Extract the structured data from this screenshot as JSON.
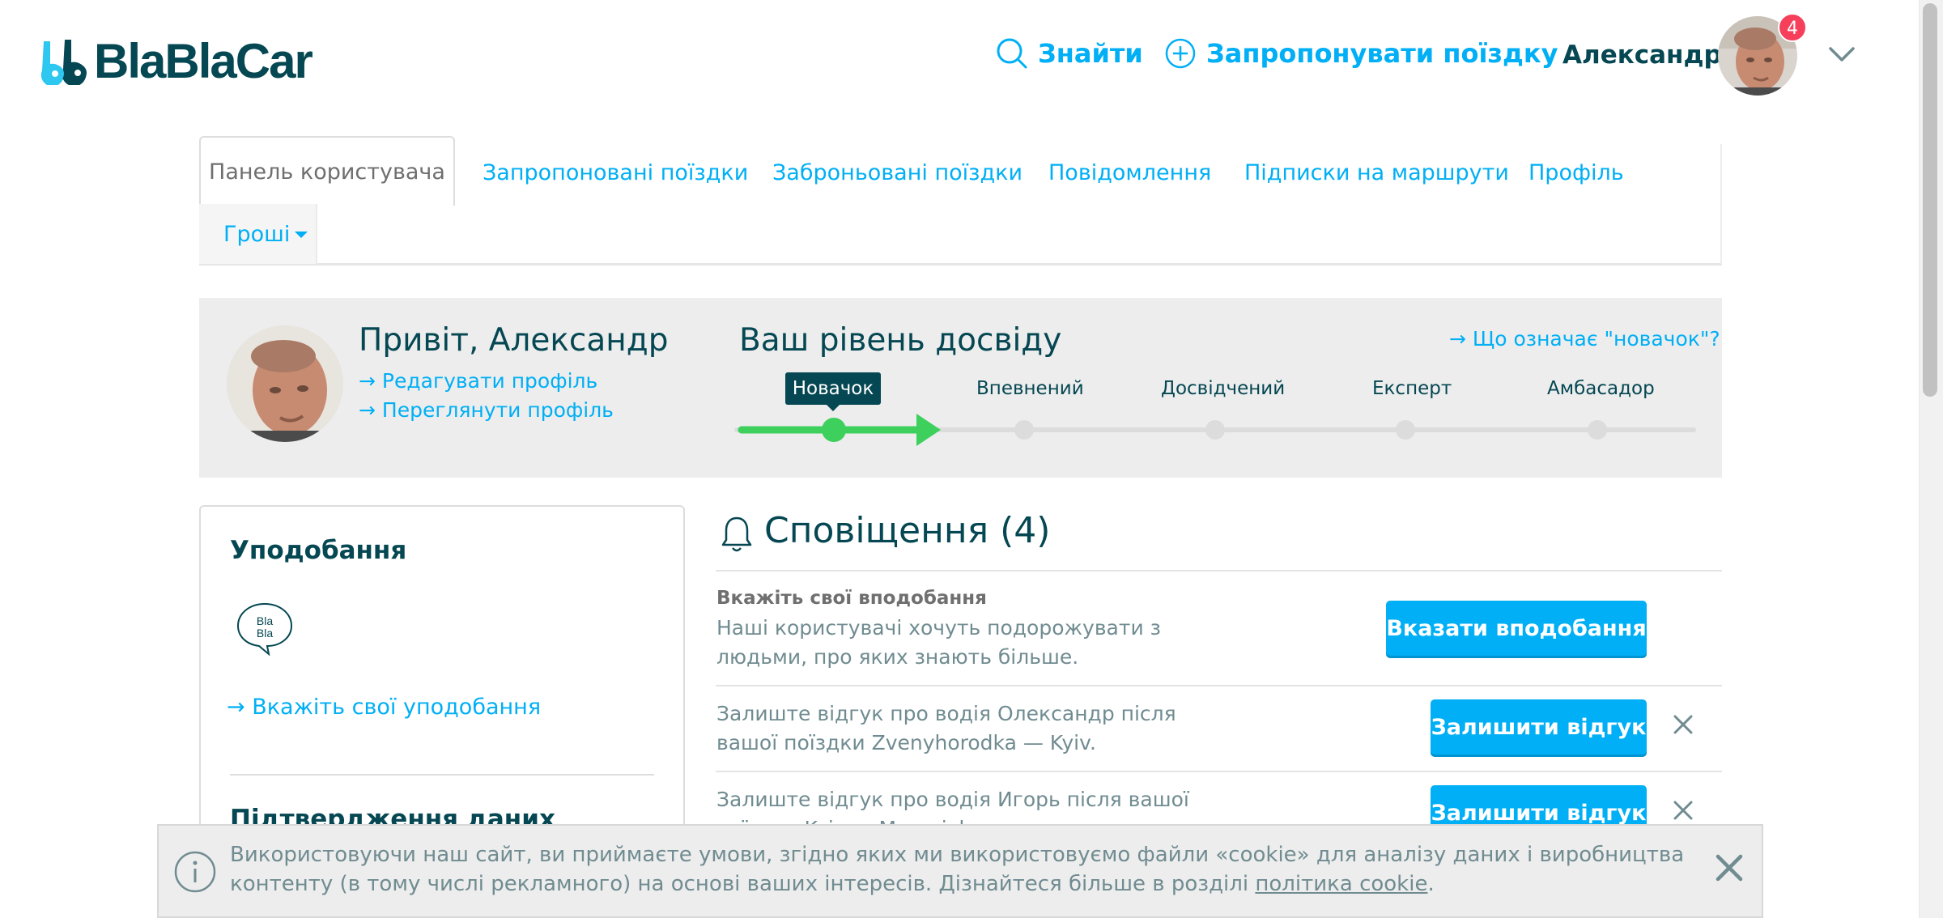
{
  "header": {
    "logo_text": "BlaBlaCar",
    "find_label": "Знайти",
    "offer_label": "Запропонувати поїздку",
    "user_name": "Александр",
    "notification_count": "4"
  },
  "tabs": {
    "dashboard": "Панель користувача",
    "offered": "Запропоновані поїздки",
    "booked": "Заброньовані поїздки",
    "messages": "Повідомлення",
    "subscriptions": "Підписки на маршрути",
    "profile": "Профіль",
    "money": "Гроші"
  },
  "hero": {
    "greeting": "Привіт, Александр",
    "edit_profile": "→ Редагувати профіль",
    "view_profile": "→ Переглянути профіль",
    "experience_title": "Ваш рівень досвіду",
    "novice_meaning": "→ Що означає \"новачок\"?",
    "levels": [
      "Новачок",
      "Впевнений",
      "Досвідчений",
      "Експерт",
      "Амбасадор"
    ],
    "current_level": "Новачок"
  },
  "preferences_card": {
    "title": "Уподобання",
    "bubble_text": "Bla Bla",
    "link": "→ Вкажіть свої уподобання",
    "verification_title": "Підтвердження даних"
  },
  "notifications": {
    "title": "Сповіщення (4)",
    "items": [
      {
        "heading": "Вкажіть свої вподобання",
        "text": "Наші користувачі хочуть подорожувати з людьми, про яких знають більше.",
        "button": "Вказати вподобання"
      },
      {
        "text": "Залиште відгук про водія Олександр після вашої поїздки Zvenyhorodka — Kyiv.",
        "button": "Залишити відгук"
      },
      {
        "text": "Залиште відгук про водія Игорь після вашої поїздки Kyiv — Myronivka.",
        "button": "Залишити відгук"
      }
    ]
  },
  "cookie_banner": {
    "text": "Використовуючи наш сайт, ви приймаєте умови, згідно яких ми використовуємо файли «cookie» для аналізу даних і виробництва контенту (в тому числі рекламного) на основі ваших інтересів. Дізнайтеся більше в розділі ",
    "link": "політика cookie",
    "suffix": "."
  },
  "colors": {
    "brand_dark": "#054752",
    "accent": "#00aff5",
    "progress_green": "#3ed05d",
    "badge_red": "#f53f5b"
  }
}
